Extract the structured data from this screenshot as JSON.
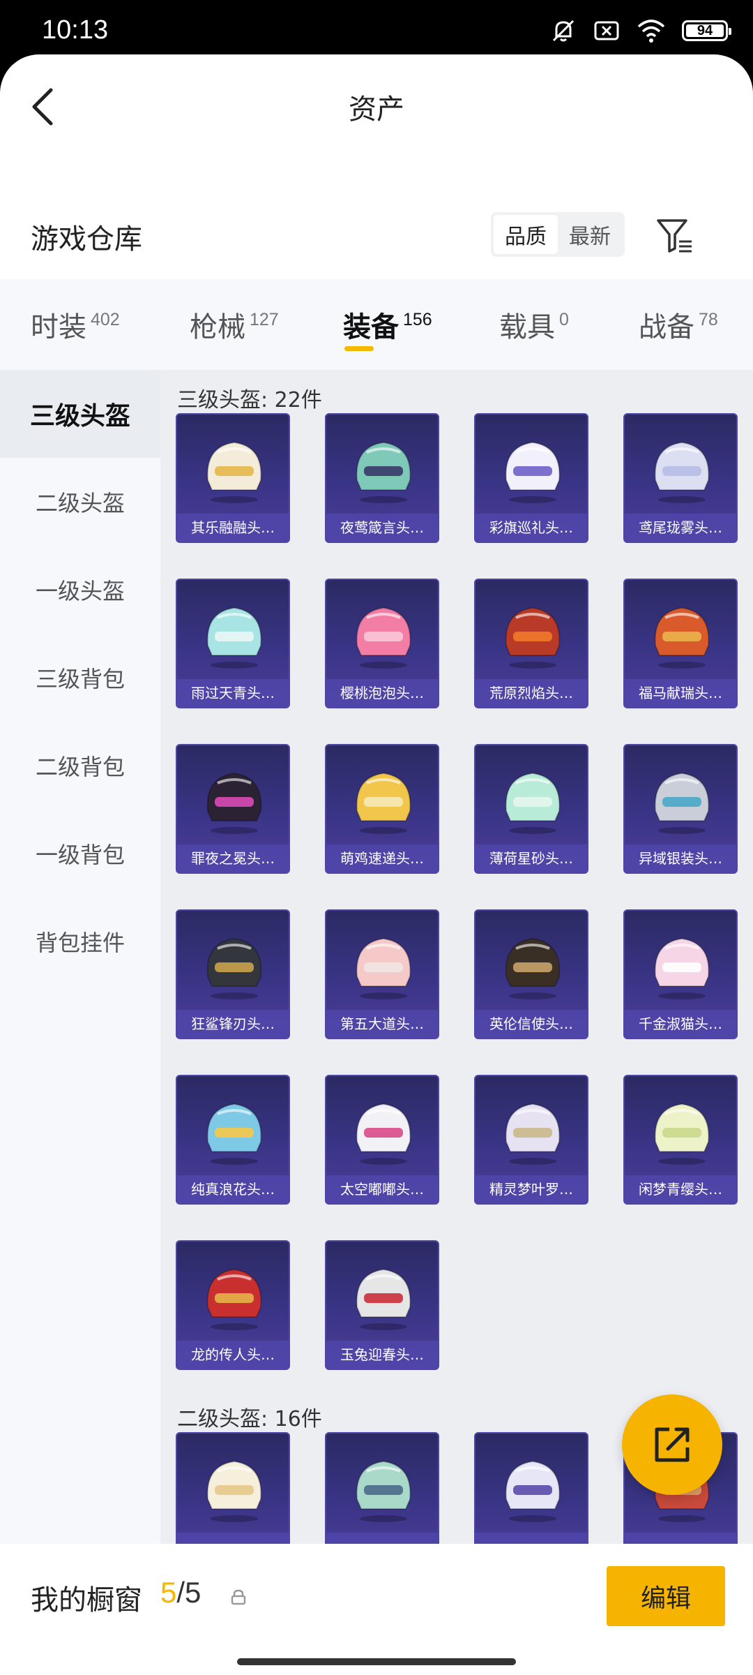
{
  "status_bar": {
    "time": "10:13",
    "battery": "94"
  },
  "header": {
    "title": "资产",
    "back_icon": "chevron-left-icon"
  },
  "warehouse": {
    "title": "游戏仓库",
    "sort_options": [
      "品质",
      "最新"
    ],
    "sort_selected": "品质",
    "filter_icon": "filter-icon"
  },
  "tabs": [
    {
      "label": "时装",
      "count": "402"
    },
    {
      "label": "枪械",
      "count": "127"
    },
    {
      "label": "装备",
      "count": "156",
      "active": true
    },
    {
      "label": "载具",
      "count": "0"
    },
    {
      "label": "战备",
      "count": "78"
    }
  ],
  "categories": [
    "三级头盔",
    "二级头盔",
    "一级头盔",
    "三级背包",
    "二级背包",
    "一级背包",
    "背包挂件"
  ],
  "category_selected": "三级头盔",
  "groups": [
    {
      "title": "三级头盔: 22件",
      "items": [
        {
          "name": "其乐融融头…",
          "color": "#f3ecd9",
          "accent": "#e6b84a"
        },
        {
          "name": "夜莺箴言头…",
          "color": "#7fc9b8",
          "accent": "#3a3a6a"
        },
        {
          "name": "彩旗巡礼头…",
          "color": "#f2f0fb",
          "accent": "#6f62c9"
        },
        {
          "name": "鸢尾珑雾头…",
          "color": "#dcdff2",
          "accent": "#b7bde6"
        },
        {
          "name": "雨过天青头…",
          "color": "#a9e4e4",
          "accent": "#e9f6f4"
        },
        {
          "name": "樱桃泡泡头…",
          "color": "#f27ea6",
          "accent": "#f9c8d9"
        },
        {
          "name": "荒原烈焰头…",
          "color": "#b93a26",
          "accent": "#f07a2a"
        },
        {
          "name": "福马献瑞头…",
          "color": "#d95a2a",
          "accent": "#e9b44a"
        },
        {
          "name": "罪夜之冕头…",
          "color": "#2b2233",
          "accent": "#d84ab5"
        },
        {
          "name": "萌鸡速递头…",
          "color": "#f2c64a",
          "accent": "#f6e8b8"
        },
        {
          "name": "薄荷星砂头…",
          "color": "#b9ecd8",
          "accent": "#e6f6ef"
        },
        {
          "name": "异域银装头…",
          "color": "#c9ced8",
          "accent": "#4aa9c9"
        },
        {
          "name": "狂鲨锋刃头…",
          "color": "#33363d",
          "accent": "#c9a24a"
        },
        {
          "name": "第五大道头…",
          "color": "#f6c9c9",
          "accent": "#f2e6e6"
        },
        {
          "name": "英伦信使头…",
          "color": "#3a2f24",
          "accent": "#c9a26a"
        },
        {
          "name": "千金淑猫头…",
          "color": "#f6d6e6",
          "accent": "#ffffff"
        },
        {
          "name": "纯真浪花头…",
          "color": "#7ec9e6",
          "accent": "#f6c94a"
        },
        {
          "name": "太空嘟嘟头…",
          "color": "#f2f2f6",
          "accent": "#d94a8a"
        },
        {
          "name": "精灵梦叶罗…",
          "color": "#e6e2f2",
          "accent": "#c9b98a"
        },
        {
          "name": "闲梦青缨头…",
          "color": "#eef2c9",
          "accent": "#c9d98a"
        },
        {
          "name": "龙的传人头…",
          "color": "#c92f2f",
          "accent": "#e6b44a"
        },
        {
          "name": "玉兔迎春头…",
          "color": "#e6e6e6",
          "accent": "#c92f3a"
        }
      ]
    },
    {
      "title": "二级头盔: 16件",
      "items": [
        {
          "name": "",
          "color": "#f6efdc",
          "accent": "#e6c98a"
        },
        {
          "name": "",
          "color": "#a9d9c9",
          "accent": "#4a6a8a"
        },
        {
          "name": "",
          "color": "#e6e6f6",
          "accent": "#5a4aa9"
        },
        {
          "name": "",
          "color": "#c94a3a",
          "accent": "#e6a96a"
        }
      ]
    }
  ],
  "fab_icon": "share-external-icon",
  "showcase": {
    "label": "我的橱窗",
    "current": "5",
    "separator": "/",
    "max": "5",
    "lock_icon": "lock-icon",
    "edit_label": "编辑"
  }
}
